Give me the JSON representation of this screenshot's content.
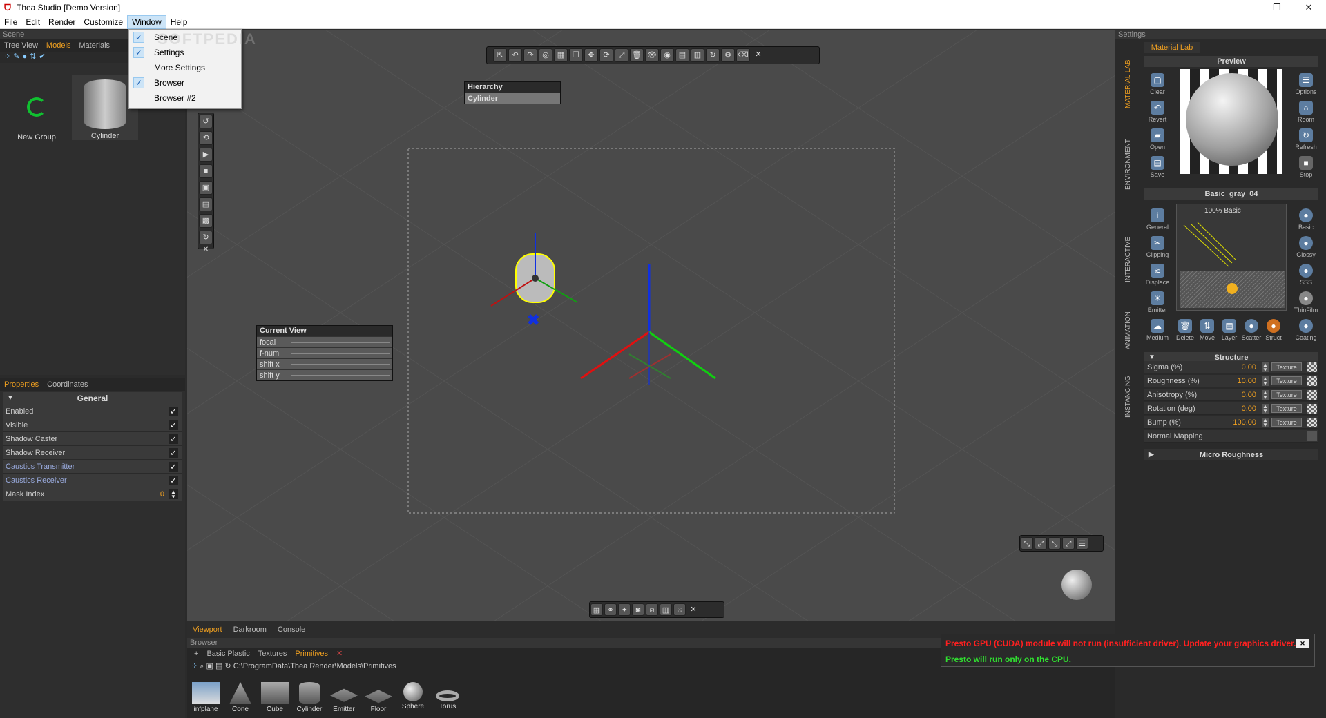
{
  "window": {
    "title": "Thea Studio [Demo Version]",
    "app_icon": "thea-logo-icon",
    "minimize": "–",
    "maximize": "❐",
    "close": "✕"
  },
  "menu": [
    "File",
    "Edit",
    "Render",
    "Customize",
    "Window",
    "Help"
  ],
  "window_menu": {
    "items": [
      {
        "label": "Scene",
        "checked": true
      },
      {
        "label": "Settings",
        "checked": true
      },
      {
        "label": "More Settings",
        "checked": false
      },
      {
        "label": "Browser",
        "checked": true
      },
      {
        "label": "Browser #2",
        "checked": false
      }
    ],
    "check_glyph": "✓"
  },
  "watermark": "SOFTPEDIA",
  "scene_panel": {
    "header": "Scene",
    "tabs": [
      "Tree View",
      "Models",
      "Materials"
    ],
    "active_tab": "Models",
    "items": [
      {
        "label": "New Group",
        "icon": "spiral-group-icon"
      },
      {
        "label": "Cylinder",
        "icon": "cylinder-icon"
      }
    ]
  },
  "properties": {
    "tabs": [
      "Properties",
      "Coordinates"
    ],
    "active_tab": "Properties",
    "section": "General",
    "rows": [
      {
        "label": "Enabled",
        "value": "✓"
      },
      {
        "label": "Visible",
        "value": "✓"
      },
      {
        "label": "Shadow Caster",
        "value": "✓"
      },
      {
        "label": "Shadow Receiver",
        "value": "✓"
      },
      {
        "label": "Caustics Transmitter",
        "value": "✓"
      },
      {
        "label": "Caustics Receiver",
        "value": "✓"
      },
      {
        "label": "Mask Index",
        "value": "0"
      }
    ]
  },
  "hierarchy": {
    "title": "Hierarchy",
    "item": "Cylinder"
  },
  "current_view": {
    "title": "Current View",
    "rows": [
      "focal",
      "f-num",
      "shift x",
      "shift y"
    ]
  },
  "viewport_tabs": [
    "Viewport",
    "Darkroom",
    "Console"
  ],
  "viewport_active_tab": "Viewport",
  "settings": {
    "header": "Settings",
    "tab": "Material Lab",
    "side_tabs": [
      "MATERIAL LAB",
      "ENVIRONMENT",
      "INTERACTIVE",
      "ANIMATION",
      "INSTANCING"
    ],
    "preview": {
      "title": "Preview",
      "left_buttons": [
        "Clear",
        "Revert",
        "Open",
        "Save"
      ],
      "right_buttons": [
        "Options",
        "Room",
        "Refresh",
        "Stop"
      ]
    },
    "material_name": "Basic_gray_04",
    "layer_label": "100% Basic",
    "left_tools": [
      "General",
      "Clipping",
      "Displace",
      "Emitter",
      "Medium"
    ],
    "right_tools": [
      "Basic",
      "Glossy",
      "SSS",
      "ThinFilm",
      "Coating"
    ],
    "bottom_tools": [
      "Delete",
      "Move",
      "Layer",
      "Scatter",
      "Struct"
    ],
    "structure": {
      "title": "Structure",
      "rows": [
        {
          "label": "Sigma (%)",
          "value": "0.00"
        },
        {
          "label": "Roughness (%)",
          "value": "10.00"
        },
        {
          "label": "Anisotropy (%)",
          "value": "0.00"
        },
        {
          "label": "Rotation (deg)",
          "value": "0.00"
        },
        {
          "label": "Bump (%)",
          "value": "100.00"
        }
      ],
      "texture_label": "Texture",
      "normal_mapping": "Normal Mapping"
    },
    "micro_roughness": "Micro Roughness"
  },
  "browser": {
    "header": "Browser",
    "tabs": [
      "Basic Plastic",
      "Textures",
      "Primitives"
    ],
    "active_tab": "Primitives",
    "path": "C:\\ProgramData\\Thea Render\\Models\\Primitives",
    "items": [
      "infplane",
      "Cone",
      "Cube",
      "Cylinder",
      "Emitter",
      "Floor",
      "Sphere",
      "Torus"
    ]
  },
  "alert": {
    "line1": "Presto GPU (CUDA) module will not run (insufficient driver). Update your graphics driver.",
    "line2": "Presto will run only on the CPU.",
    "line1_color": "#ff2020",
    "line2_color": "#30e030",
    "close": "✕"
  },
  "colors": {
    "accent": "#f0a020",
    "axis_x": "#e01010",
    "axis_y": "#10d010",
    "axis_z": "#1030e0"
  }
}
